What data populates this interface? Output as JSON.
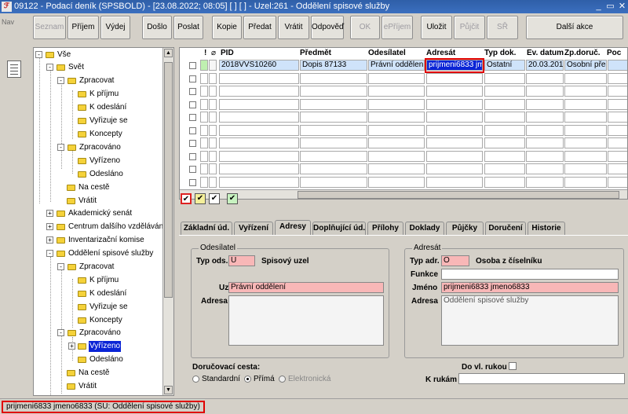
{
  "window": {
    "title": "09122 - Podací deník (SPSBOLD) - [23.08.2022; 08:05]  [ ]  [ ] - Uzel:261 - Oddělení spisové služby",
    "controls": [
      "_",
      "▭",
      "✕"
    ]
  },
  "nav": {
    "label": "Nav"
  },
  "toolbar": {
    "buttons": [
      "Seznam",
      "Příjem",
      "Výdej",
      "Došlo",
      "Poslat",
      "Kopie",
      "Předat",
      "Vrátit",
      "Odpověď",
      "OK",
      "ePříjem",
      "Uložit",
      "Půjčit",
      "SŘ",
      "Další akce"
    ],
    "disabled": [
      "Seznam",
      "OK",
      "ePříjem",
      "Půjčit",
      "SŘ"
    ]
  },
  "tree": {
    "items": [
      "Vše",
      "Svět",
      "Zpracovat",
      "K příjmu",
      "K odeslání",
      "Vyřizuje se",
      "Koncepty",
      "Zpracováno",
      "Vyřízeno",
      "Odesláno",
      "Na cestě",
      "Vrátit",
      "Akademický senát",
      "Centrum dalšího vzdělávání",
      "Inventarizační komise",
      "Oddělení spisové služby",
      "Zpracovat",
      "K příjmu",
      "K odeslání",
      "Vyřizuje se",
      "Koncepty",
      "Zpracováno",
      "Vyřízeno",
      "Odesláno",
      "Na cestě",
      "Vrátit"
    ]
  },
  "grid": {
    "columns": [
      "!",
      "PID",
      "Předmět",
      "Odesílatel",
      "Adresát",
      "Typ dok.",
      "Ev. datum",
      "Zp.doruč.",
      "Poc"
    ],
    "row": {
      "pid": "2018VVS10260",
      "predmet": "Dopis 87133",
      "odesilatel": "Právní oddělení",
      "adresat": "prijmeni6833 jmeno6",
      "typ_dok": "Ostatní",
      "ev_datum": "20.03.2018",
      "zp_doruc": "Osobní předá"
    }
  },
  "tabs": [
    "Základní úd.",
    "Vyřízení",
    "Adresy",
    "Doplňující úd.",
    "Přílohy",
    "Doklady",
    "Půjčky",
    "Doručení",
    "Historie"
  ],
  "active_tab": "Adresy",
  "odesilatel": {
    "group_label": "Odesílatel",
    "typ_ods_label": "Typ ods.",
    "typ_ods_value": "U",
    "typ_ods_desc": "Spisový uzel",
    "uzel_label": "Uzel",
    "uzel_value": "Právní oddělení",
    "adresa_label": "Adresa",
    "adresa_value": ""
  },
  "adresat": {
    "group_label": "Adresát",
    "typ_adr_label": "Typ adr.",
    "typ_adr_value": "O",
    "typ_adr_desc": "Osoba z číselníku",
    "funkce_label": "Funkce",
    "funkce_value": "",
    "jmeno_label": "Jméno",
    "jmeno_value": "prijmeni6833 jmeno6833",
    "adresa_label": "Adresa",
    "adresa_value": "Oddělení spisové služby"
  },
  "delivery": {
    "cesta_label": "Doručovací cesta:",
    "options": [
      "Standardní",
      "Přímá",
      "Elektronická"
    ],
    "selected": "Přímá",
    "do_vl_rukou_label": "Do vl. rukou",
    "k_rukam_label": "K rukám",
    "k_rukam_value": ""
  },
  "status": {
    "text": "prijmeni6833 jmeno6833 (SU: Oddělení spisové služby)"
  }
}
